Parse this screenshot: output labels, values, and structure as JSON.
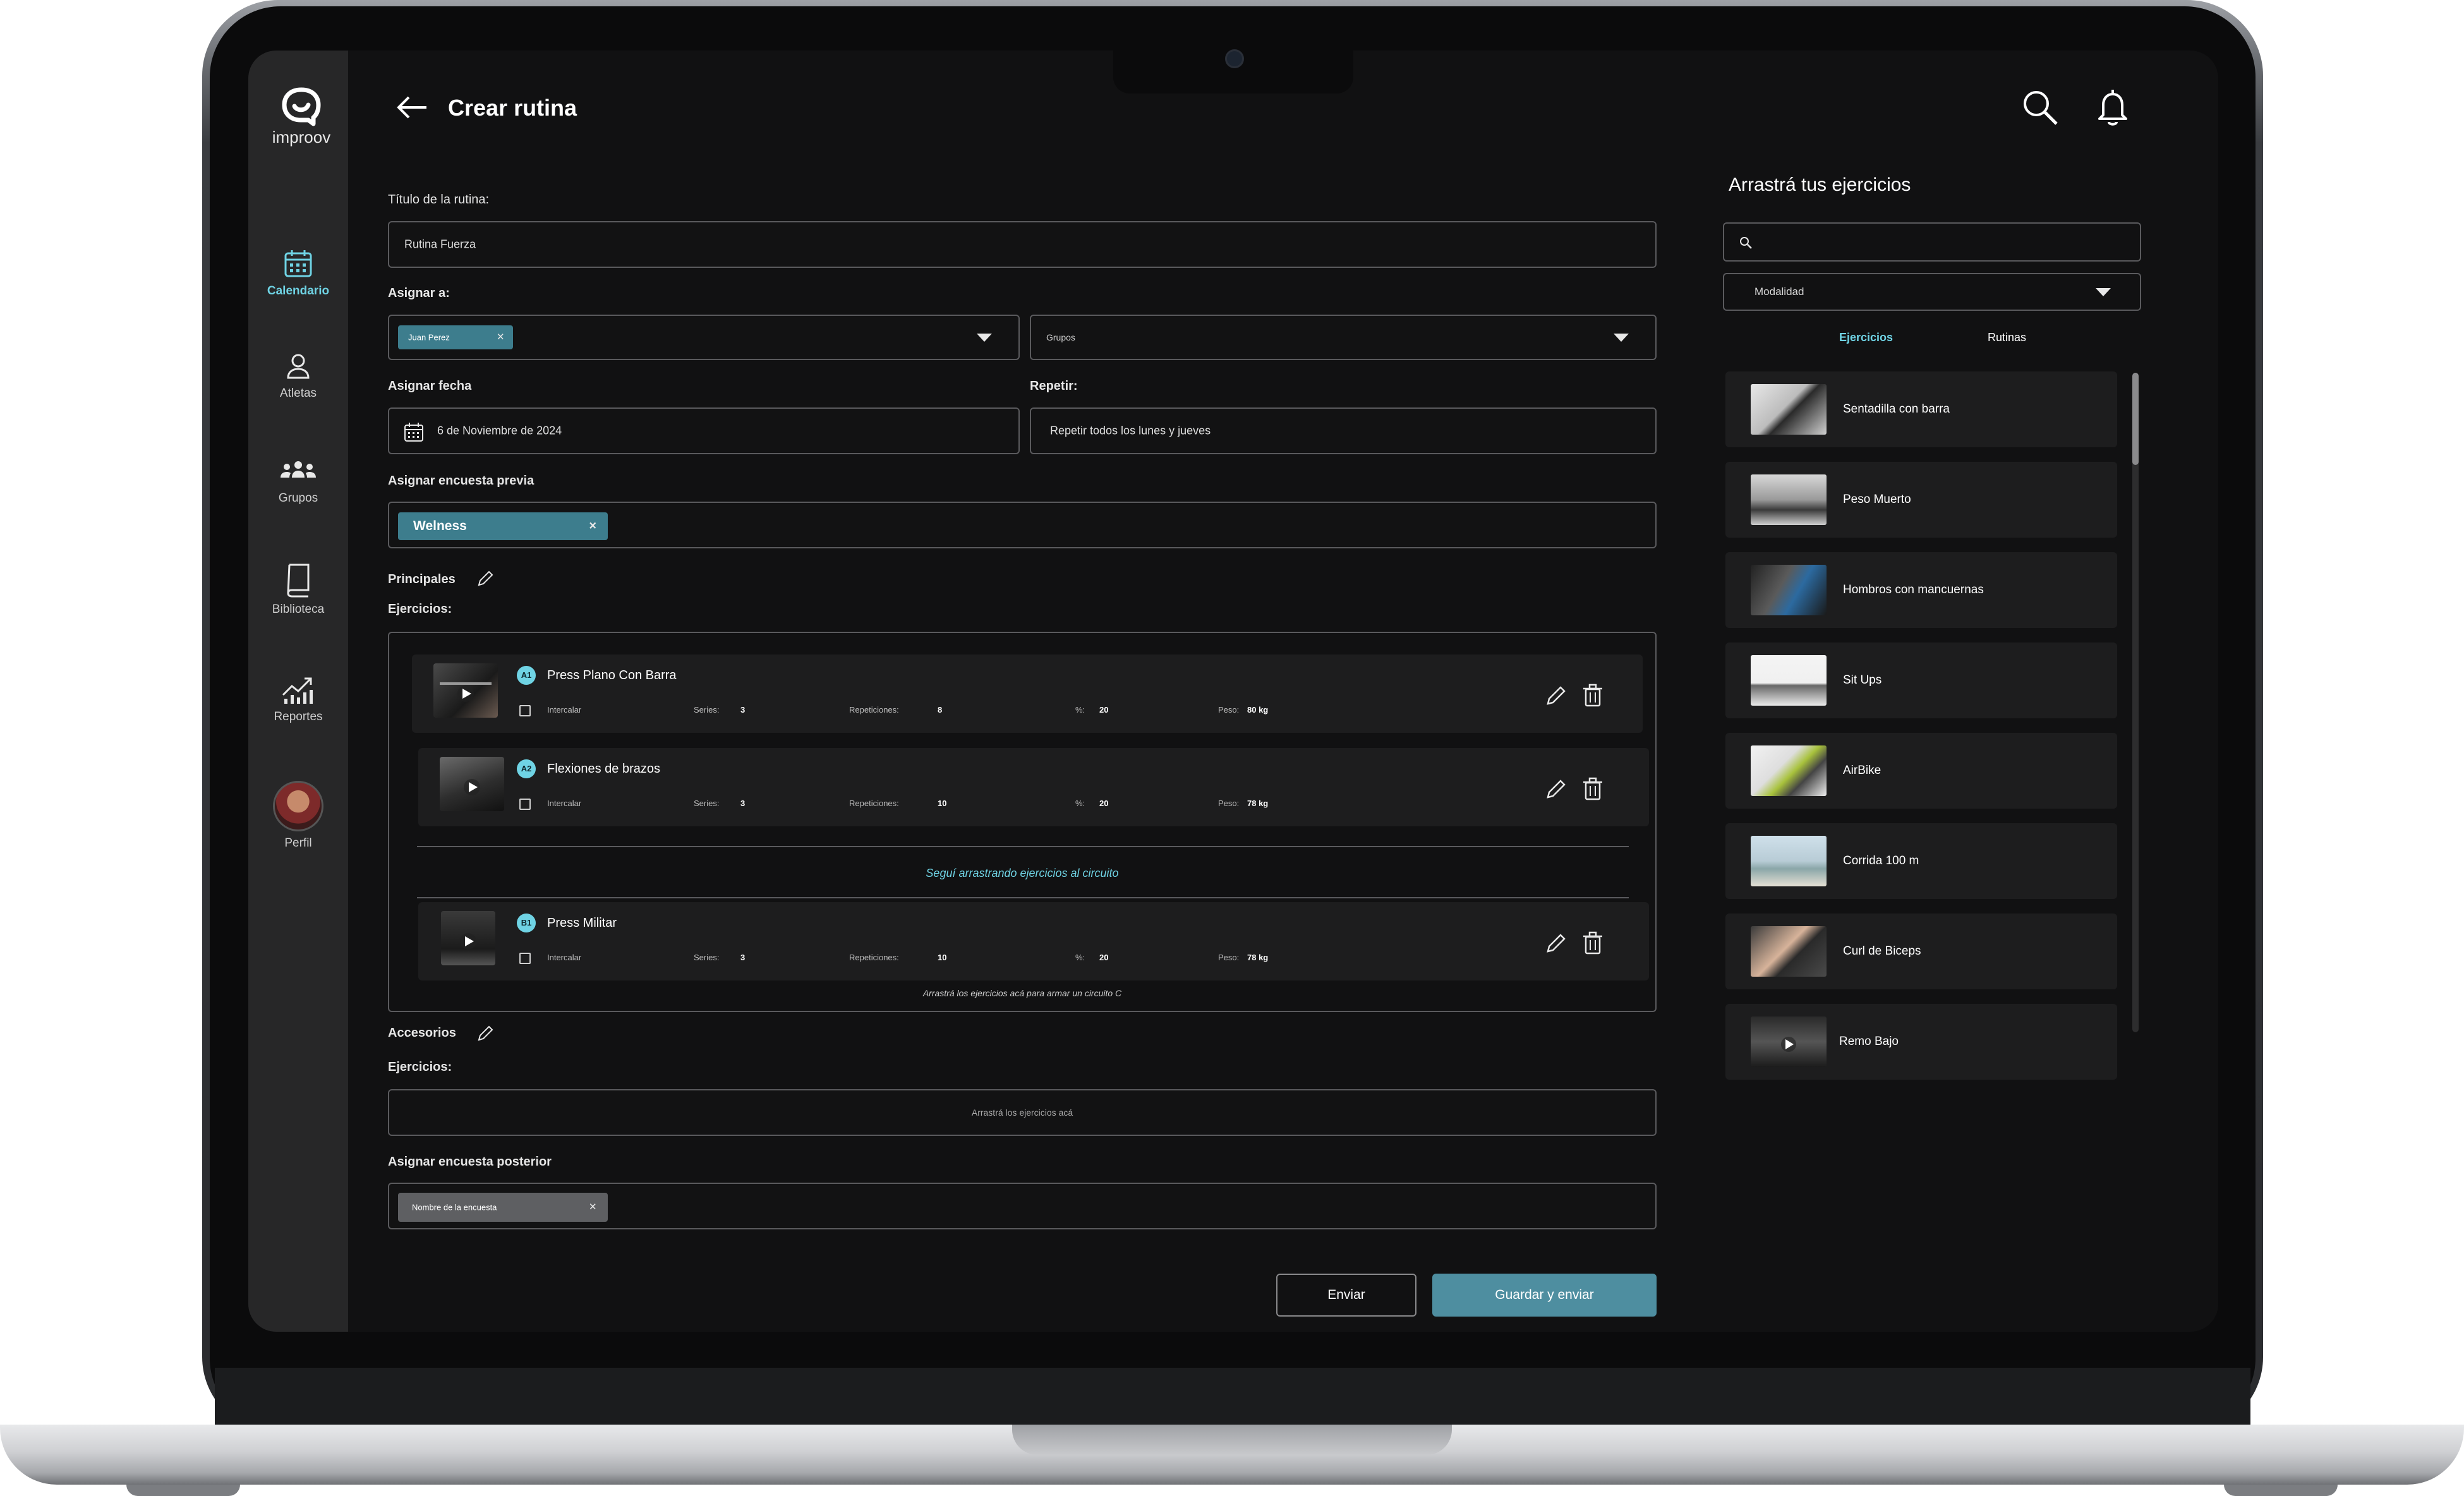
{
  "app": {
    "brand": "improov",
    "page_title": "Crear rutina"
  },
  "sidebar": {
    "items": [
      {
        "label": "Calendario",
        "icon": "calendar-icon",
        "active": true
      },
      {
        "label": "Atletas",
        "icon": "person-icon",
        "active": false
      },
      {
        "label": "Grupos",
        "icon": "group-icon",
        "active": false
      },
      {
        "label": "Biblioteca",
        "icon": "book-icon",
        "active": false
      },
      {
        "label": "Reportes",
        "icon": "chart-icon",
        "active": false
      }
    ],
    "profile_label": "Perfil"
  },
  "form": {
    "title_label": "Título de la rutina:",
    "title_value": "Rutina Fuerza",
    "assign_label": "Asignar a:",
    "assign_chip": "Juan Perez",
    "groups_placeholder": "Grupos",
    "date_label": "Asignar fecha",
    "date_value": "6 de Noviembre de 2024",
    "repeat_label": "Repetir:",
    "repeat_value": "Repetir todos los lunes y jueves",
    "pre_survey_label": "Asignar encuesta previa",
    "pre_survey_chip": "Welness",
    "principales_label": "Principales",
    "exercises_label": "Ejercicios:",
    "circuit_hint": "Seguí arrastrando ejercicios al circuito",
    "circuit_c_hint": "Arrastrá los ejercicios acá para armar un circuito C",
    "accesorios_label": "Accesorios",
    "accesorios_exercises_label": "Ejercicios:",
    "accesorios_drop_hint": "Arrastrá los ejercicios acá",
    "post_survey_label": "Asignar encuesta posterior",
    "post_survey_chip": "Nombre de la encuesta",
    "send_label": "Enviar",
    "save_send_label": "Guardar y enviar"
  },
  "exercise_labels": {
    "intercalar": "Intercalar",
    "series": "Series:",
    "repeticiones": "Repeticiones:",
    "percent": "%:",
    "peso": "Peso:"
  },
  "exercises": [
    {
      "badge": "A1",
      "name": "Press Plano Con Barra",
      "series": "3",
      "reps": "8",
      "percent": "20",
      "weight": "80 kg"
    },
    {
      "badge": "A2",
      "name": "Flexiones de brazos",
      "series": "3",
      "reps": "10",
      "percent": "20",
      "weight": "78 kg"
    },
    {
      "badge": "B1",
      "name": "Press Militar",
      "series": "3",
      "reps": "10",
      "percent": "20",
      "weight": "78 kg"
    }
  ],
  "library": {
    "title": "Arrastrá tus ejercicios",
    "search_placeholder": "",
    "modality_label": "Modalidad",
    "tabs": [
      {
        "label": "Ejercicios",
        "active": true
      },
      {
        "label": "Rutinas",
        "active": false
      }
    ],
    "items": [
      {
        "name": "Sentadilla con barra"
      },
      {
        "name": "Peso Muerto"
      },
      {
        "name": "Hombros con mancuernas"
      },
      {
        "name": "Sit Ups"
      },
      {
        "name": "AirBike"
      },
      {
        "name": "Corrida 100 m"
      },
      {
        "name": "Curl de Biceps"
      },
      {
        "name": "Remo Bajo"
      }
    ]
  },
  "colors": {
    "accent": "#6fd3e4",
    "chip": "#3d7d8d",
    "background": "#111112",
    "sidebar": "#272728"
  }
}
